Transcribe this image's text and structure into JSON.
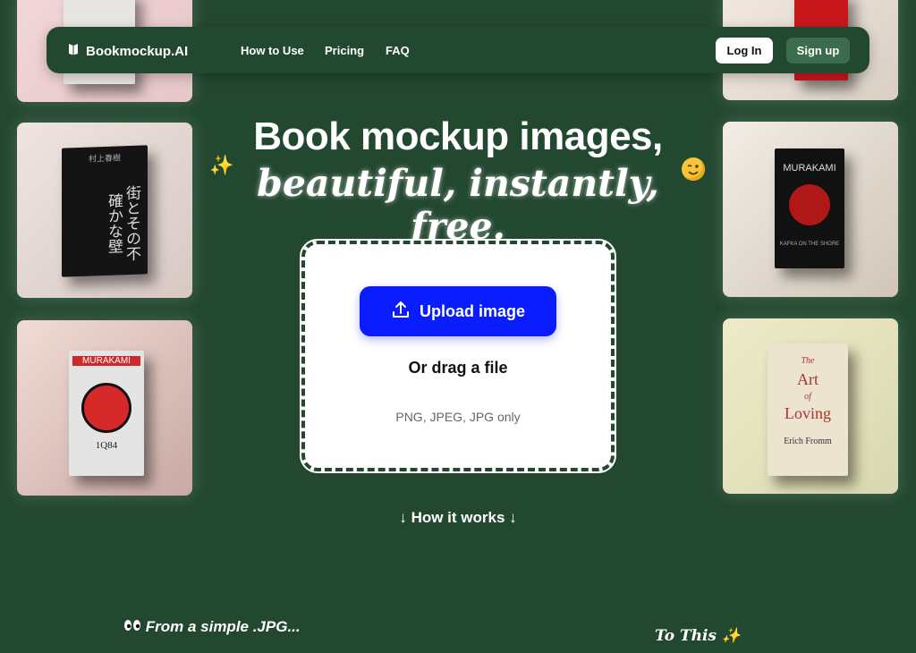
{
  "nav": {
    "brand": "Bookmockup.AI",
    "links": [
      "How to Use",
      "Pricing",
      "FAQ"
    ],
    "login": "Log In",
    "signup": "Sign up"
  },
  "hero": {
    "line1": "Book mockup images,",
    "line2": "beautiful, instantly, free."
  },
  "upload": {
    "button": "Upload image",
    "drag": "Or drag a file",
    "formats": "PNG, JPEG, JPG only"
  },
  "how_it_works": "↓ How it works ↓",
  "from_text": "From a simple .JPG...",
  "to_text": "To This ✨",
  "books": {
    "left_mid_title": "街とその不確かな壁",
    "left_mid_author": "村上春樹",
    "left_bottom_author": "MURAKAMI",
    "left_bottom_title": "1Q84",
    "right_mid_author": "MURAKAMI",
    "right_mid_title": "KAFKA ON THE SHORE",
    "right_bottom_line1": "The",
    "right_bottom_line2": "Art",
    "right_bottom_line3": "of",
    "right_bottom_line4": "Loving",
    "right_bottom_author": "Erich Fromm"
  },
  "colors": {
    "background": "#234830",
    "upload_button": "#0a1dff",
    "signup_button": "#3b6d4c"
  },
  "icons": {
    "brand": "book-icon",
    "upload": "upload-icon",
    "sparkles": "sparkles-icon",
    "wink": "wink-face-icon",
    "eyes": "eyes-icon"
  }
}
